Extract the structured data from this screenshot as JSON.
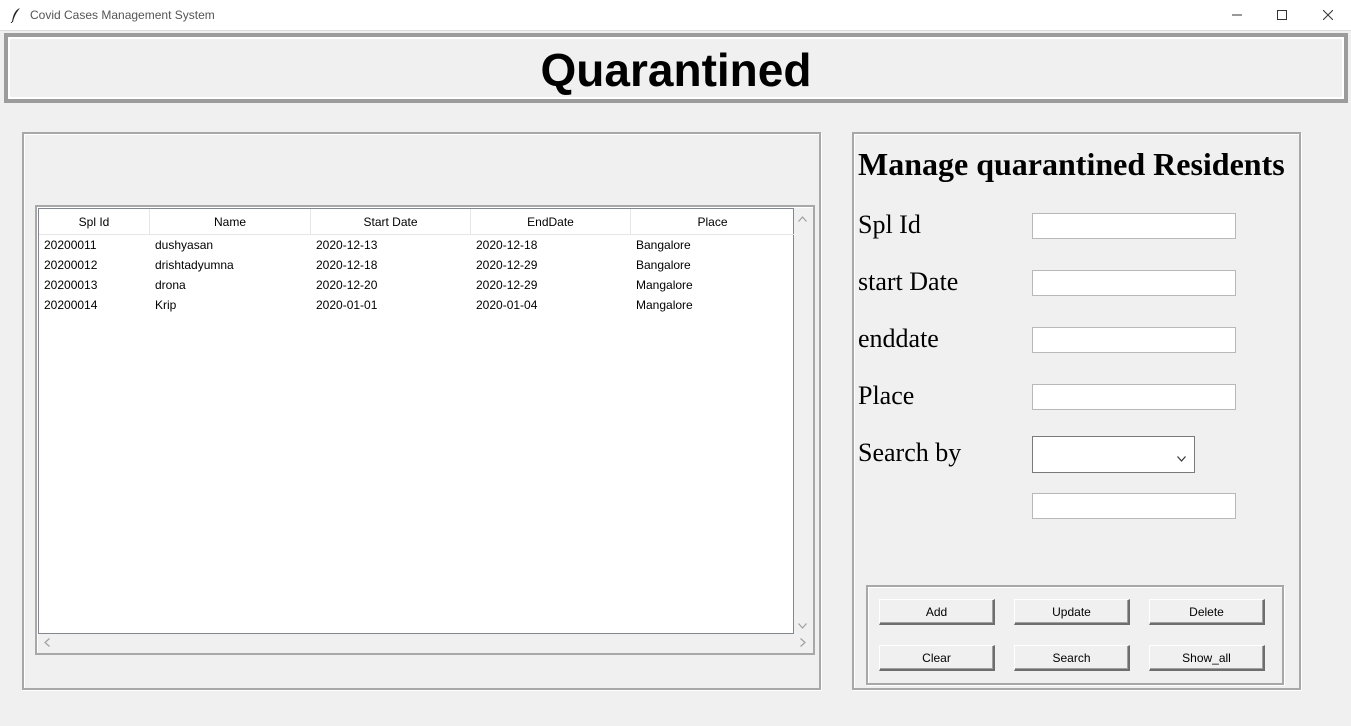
{
  "window": {
    "title": "Covid Cases Management System"
  },
  "header": {
    "title": "Quarantined"
  },
  "table": {
    "columns": [
      "Spl Id",
      "Name",
      "Start Date",
      "EndDate",
      "Place"
    ],
    "rows": [
      [
        "20200011",
        "dushyasan",
        "2020-12-13",
        "2020-12-18",
        "Bangalore"
      ],
      [
        "20200012",
        "drishtadyumna",
        "2020-12-18",
        "2020-12-29",
        "Bangalore"
      ],
      [
        "20200013",
        "drona",
        "2020-12-20",
        "2020-12-29",
        "Mangalore"
      ],
      [
        "20200014",
        "Krip",
        "2020-01-01",
        "2020-01-04",
        "Mangalore"
      ]
    ]
  },
  "form": {
    "title": "Manage quarantined Residents",
    "spl_id_label": "Spl Id",
    "start_date_label": "start Date",
    "enddate_label": "enddate",
    "place_label": "Place",
    "search_by_label": "Search by",
    "spl_id_value": "",
    "start_date_value": "",
    "enddate_value": "",
    "place_value": "",
    "search_by_value": "",
    "search_value": ""
  },
  "buttons": {
    "add": "Add",
    "update": "Update",
    "delete": "Delete",
    "clear": "Clear",
    "search": "Search",
    "show_all": "Show_all"
  },
  "icons": {
    "app": "feather-icon",
    "minimize": "minimize-icon",
    "maximize": "maximize-icon",
    "close": "close-icon"
  }
}
